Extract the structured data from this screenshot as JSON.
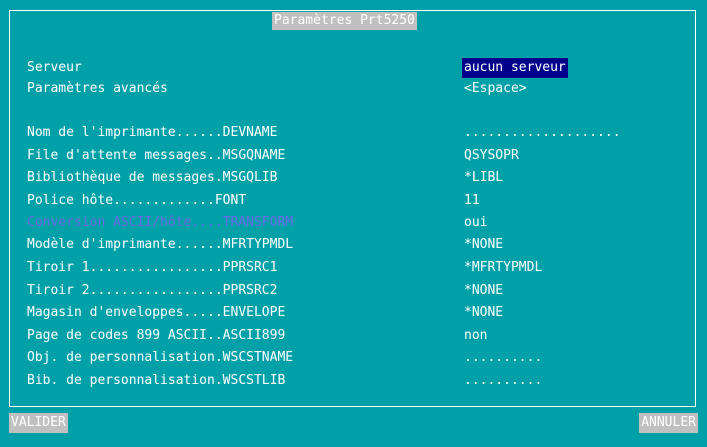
{
  "dialog": {
    "title": "Paramètres Prt5250"
  },
  "rows": [
    {
      "label": "Serveur",
      "value": "aucun serveur"
    },
    {
      "label": "Paramètres avancés",
      "value": "<Espace>"
    },
    {
      "label": "Nom de l'imprimante......DEVNAME",
      "value": "...................."
    },
    {
      "label": "File d'attente messages..MSGQNAME",
      "value": "QSYSOPR"
    },
    {
      "label": "Bibliothèque de messages.MSGQLIB",
      "value": "*LIBL"
    },
    {
      "label": "Police hôte.............FONT",
      "value": "11"
    },
    {
      "label": "Conversion ASCII/hôte....TRANSFORM",
      "value": "oui"
    },
    {
      "label": "Modèle d'imprimante......MFRTYPMDL",
      "value": "*NONE"
    },
    {
      "label": "Tiroir 1.................PPRSRC1",
      "value": "*MFRTYPMDL"
    },
    {
      "label": "Tiroir 2.................PPRSRC2",
      "value": "*NONE"
    },
    {
      "label": "Magasin d'enveloppes.....ENVELOPE",
      "value": "*NONE"
    },
    {
      "label": "Page de codes 899 ASCII..ASCII899",
      "value": "non"
    },
    {
      "label": "Obj. de personnalisation.WSCSTNAME",
      "value": ".........."
    },
    {
      "label": "Bib. de personnalisation.WSCSTLIB",
      "value": ".........."
    }
  ],
  "buttons": {
    "validate": "VALIDER",
    "cancel": "ANNULER"
  },
  "colors": {
    "background": "#00a0a8",
    "selected_bg": "#00008b",
    "disabled_text": "#6a6ae8",
    "button_bg": "#c0c0c0"
  }
}
